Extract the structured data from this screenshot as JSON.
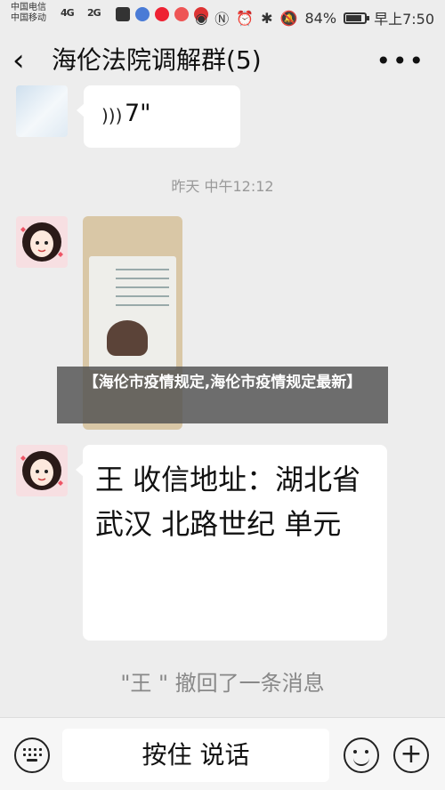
{
  "status_bar": {
    "carrier_1": "中国电信",
    "carrier_2": "中国移动",
    "signal_1": "4G",
    "signal_2": "2G",
    "battery": "84%",
    "time": "早上7:50"
  },
  "titlebar": {
    "title": "海伦法院调解群(5)"
  },
  "chat": {
    "voice_length": "7\"",
    "timestamp": "昨天 中午12:12",
    "message_text": "王 收信地址：湖北省武汉 北路世纪 单元",
    "recall_notice": "\"王 \" 撤回了一条消息"
  },
  "overlay": {
    "caption": "【海伦市疫情规定,海伦市疫情规定最新】"
  },
  "input_bar": {
    "hold_to_talk": "按住 说话"
  },
  "icons": {
    "back": "back-arrow-icon",
    "more": "more-dots-icon",
    "voice": "voice-wave-icon",
    "keyboard": "keyboard-icon",
    "emoji": "emoji-icon",
    "plus": "plus-icon"
  }
}
